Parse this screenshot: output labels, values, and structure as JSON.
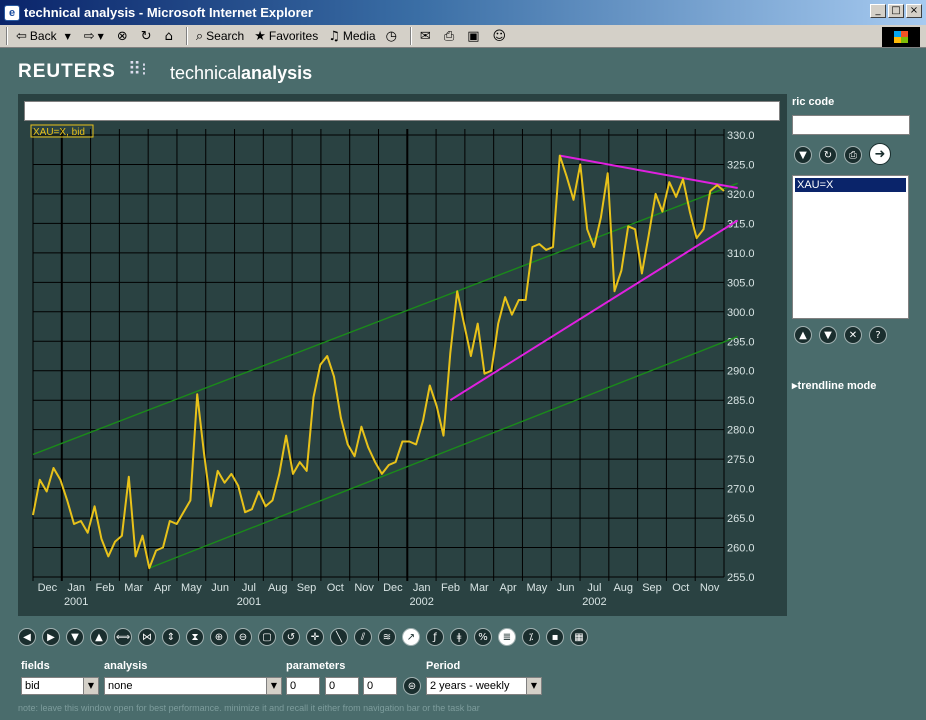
{
  "window": {
    "title": "technical analysis - Microsoft Internet Explorer",
    "buttons": [
      "_",
      "□",
      "×"
    ]
  },
  "toolbar": {
    "back": "Back",
    "search": "Search",
    "favorites": "Favorites",
    "media": "Media"
  },
  "header": {
    "brand": "REUTERS",
    "product_light": "technical",
    "product_bold": "analysis"
  },
  "chart": {
    "instrument_label": "XAU=X, bid",
    "colors": {
      "price": "#e8c21a",
      "channel": "#1a8a1a",
      "triangle": "#e020e0",
      "grid": "#000000",
      "panel": "#2a4242",
      "axis_text": "#d8e4e4"
    }
  },
  "chart_data": {
    "type": "line",
    "title": "",
    "ylim": [
      255,
      330
    ],
    "yticks": [
      255.0,
      260.0,
      265.0,
      270.0,
      275.0,
      280.0,
      285.0,
      290.0,
      295.0,
      300.0,
      305.0,
      310.0,
      315.0,
      320.0,
      325.0,
      330.0
    ],
    "month_labels": [
      "Dec",
      "Jan",
      "Feb",
      "Mar",
      "Apr",
      "May",
      "Jun",
      "Jul",
      "Aug",
      "Sep",
      "Oct",
      "Nov",
      "Dec",
      "Jan",
      "Feb",
      "Mar",
      "Apr",
      "May",
      "Jun",
      "Jul",
      "Aug",
      "Sep",
      "Oct",
      "Nov"
    ],
    "year_labels": [
      {
        "label": "2001",
        "month_index": 1
      },
      {
        "label": "2001",
        "month_index": 7
      },
      {
        "label": "2002",
        "month_index": 13
      },
      {
        "label": "2002",
        "month_index": 19
      }
    ],
    "series": [
      {
        "values": [
          265.5,
          271.5,
          269.5,
          273.5,
          271.5,
          268,
          264,
          264.5,
          262.5,
          267,
          261.5,
          258.5,
          261,
          262,
          272,
          258.5,
          262,
          256.5,
          259.5,
          260,
          264.5,
          264,
          266,
          268,
          286,
          276,
          267,
          273,
          271,
          272.5,
          270.5,
          266,
          266.5,
          269.5,
          267,
          268,
          272.5,
          279,
          272.5,
          274.5,
          273,
          285.5,
          291,
          292.5,
          289,
          282,
          277.5,
          275.5,
          280.5,
          277,
          274.5,
          272.5,
          274,
          274.5,
          278,
          278,
          277.5,
          281.5,
          287.5,
          284,
          279,
          293,
          303.5,
          298,
          292.5,
          298,
          289.5,
          290,
          298,
          302.5,
          299.5,
          302,
          302,
          311,
          311.5,
          310.5,
          311,
          326.5,
          323,
          319,
          325,
          314,
          311,
          316,
          323.5,
          303.5,
          307,
          314.5,
          314,
          306.5,
          313,
          320,
          317,
          322,
          319.5,
          322.5,
          317,
          312.5,
          314,
          320.5,
          321.5,
          320.5
        ]
      }
    ],
    "trendlines": [
      {
        "name": "channel-upper",
        "from": [
          0,
          275.8
        ],
        "to": [
          103,
          321.8
        ]
      },
      {
        "name": "channel-lower",
        "from": [
          17,
          256.5
        ],
        "to": [
          103,
          295.8
        ]
      },
      {
        "name": "triangle-upper",
        "from": [
          77,
          326.5
        ],
        "to": [
          103,
          321
        ]
      },
      {
        "name": "triangle-lower",
        "from": [
          61,
          285
        ],
        "to": [
          103,
          315.5
        ]
      }
    ]
  },
  "right_panel": {
    "ric_label": "ric code",
    "ric_value": "",
    "list_items": [
      "XAU=X"
    ],
    "trendline_mode": "trendline mode"
  },
  "form": {
    "fields_label": "fields",
    "fields_value": "bid",
    "analysis_label": "analysis",
    "analysis_value": "none",
    "parameters_label": "parameters",
    "param1": "0",
    "param2": "0",
    "param3": "0",
    "period_label": "Period",
    "period_value": "2 years - weekly"
  },
  "status": "note: leave this window open for best performance. minimize it and recall it either from navigation bar or the task bar"
}
